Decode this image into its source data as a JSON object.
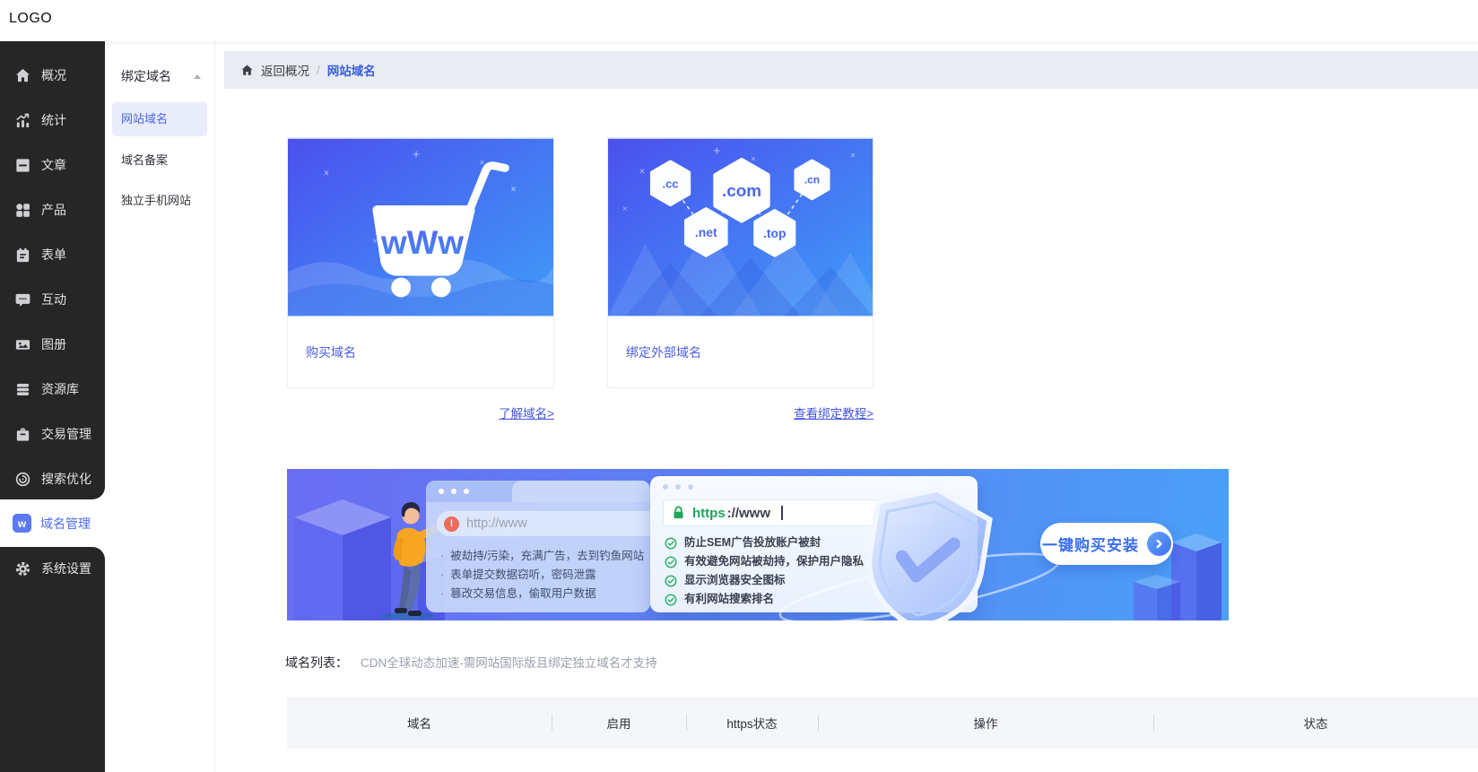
{
  "topbar": {
    "logo": "LOGO"
  },
  "sidebar": {
    "items": [
      {
        "label": "概况",
        "icon": "home-icon"
      },
      {
        "label": "统计",
        "icon": "chart-icon"
      },
      {
        "label": "文章",
        "icon": "article-icon"
      },
      {
        "label": "产品",
        "icon": "product-icon"
      },
      {
        "label": "表单",
        "icon": "form-icon"
      },
      {
        "label": "互动",
        "icon": "chat-icon"
      },
      {
        "label": "图册",
        "icon": "gallery-icon"
      },
      {
        "label": "资源库",
        "icon": "database-icon"
      },
      {
        "label": "交易管理",
        "icon": "trade-icon"
      },
      {
        "label": "搜索优化",
        "icon": "seo-icon"
      }
    ],
    "active_item": {
      "label": "域名管理",
      "icon": "w-badge-icon",
      "badge_letter": "w"
    },
    "bottom_item": {
      "label": "系统设置",
      "icon": "gear-icon"
    }
  },
  "submenu": {
    "group_label": "绑定域名",
    "items": [
      {
        "label": "网站域名",
        "active": true
      },
      {
        "label": "域名备案",
        "active": false
      },
      {
        "label": "独立手机网站",
        "active": false
      }
    ]
  },
  "breadcrumb": {
    "back": "返回概况",
    "separator": "/",
    "current": "网站域名"
  },
  "cards": [
    {
      "label": "购买域名",
      "link": "了解域名>",
      "art_text": "wWw"
    },
    {
      "label": "绑定外部域名",
      "link": "查看绑定教程>",
      "hexagons": [
        ".cc",
        ".com",
        ".cn",
        ".net",
        ".top"
      ]
    }
  ],
  "banner": {
    "http_panel": {
      "alert_icon": "!",
      "url": "http://www",
      "bullets": [
        "被劫持/污染，充满广告，去到钓鱼网站",
        "表单提交数据窃听，密码泄露",
        "篡改交易信息，偷取用户数据"
      ]
    },
    "https_panel": {
      "url_scheme": "https",
      "url_rest": "://www",
      "checks": [
        "防止SEM广告投放账户被封",
        "有效避免网站被劫持，保护用户隐私",
        "显示浏览器安全图标",
        "有利网站搜索排名"
      ]
    },
    "button_label": "一键购买安装"
  },
  "domain_list": {
    "title": "域名列表：",
    "note": "CDN全球动态加速-需网站国际版且绑定独立域名才支持",
    "columns": [
      "域名",
      "启用",
      "https状态",
      "操作",
      "状态"
    ]
  },
  "colors": {
    "accent": "#4a66e8",
    "sidebar_dark": "#262626",
    "banner_gradient_start": "#6a6df3",
    "banner_gradient_end": "#4aa0f8",
    "success_green": "#27b35e",
    "danger_red": "#ee6a5c",
    "link_blue": "#4456dd"
  }
}
